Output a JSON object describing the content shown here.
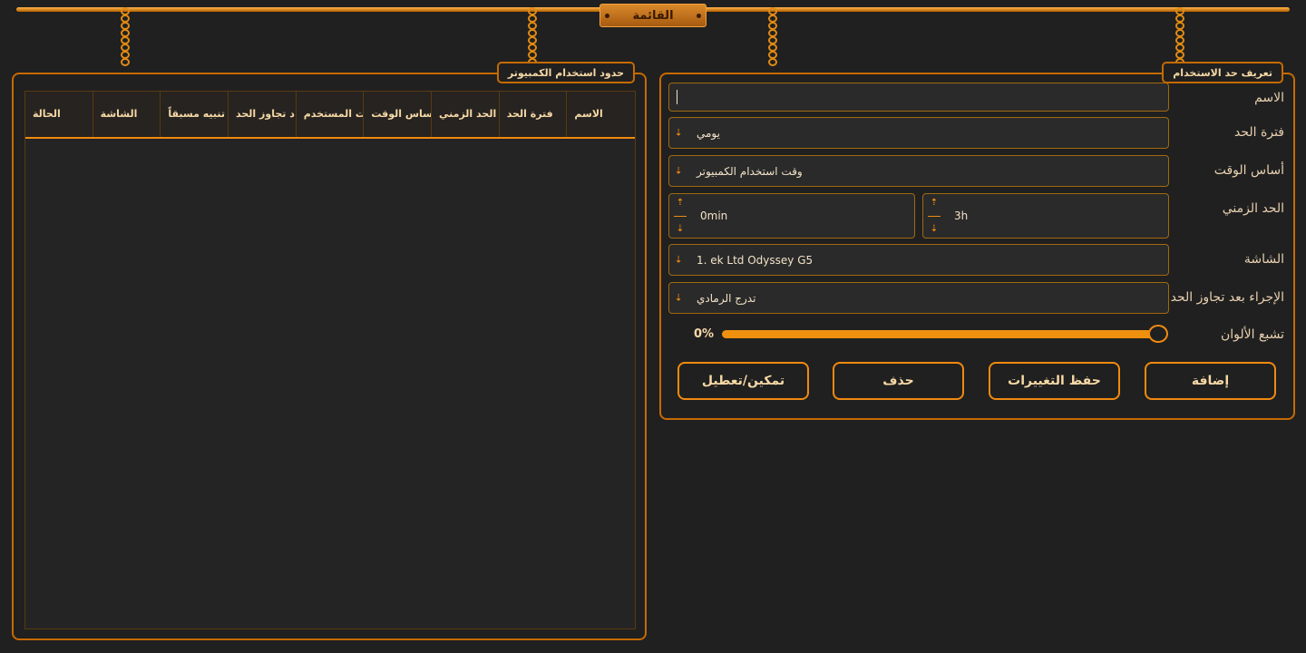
{
  "menu": {
    "label": "القائمة"
  },
  "left_panel": {
    "title": "حدود استخدام الكمبيوتر",
    "columns": [
      "الاسم",
      "فترة الحد",
      "الحد الزمني",
      "ساس الوقت",
      "ت المستخدم",
      "د تجاوز الحد",
      "تنبيه مسبقاً",
      "الشاشة",
      "الحالة"
    ],
    "rows": []
  },
  "right_panel": {
    "title": "تعريف حد الاستخدام",
    "name": {
      "label": "الاسم",
      "value": ""
    },
    "period": {
      "label": "فترة الحد",
      "value": "يومي"
    },
    "time_basis": {
      "label": "أساس الوقت",
      "value": "وقت استخدام الكمبيوتر"
    },
    "time_limit": {
      "label": "الحد الزمني",
      "hours": "3h",
      "minutes": "0min"
    },
    "monitor": {
      "label": "الشاشة",
      "value": "1. ek Ltd Odyssey G5"
    },
    "action": {
      "label": "الإجراء بعد تجاوز الحد",
      "value": "تدرج الرمادي"
    },
    "saturation": {
      "label": "تشبع الألوان",
      "value": "0%",
      "fill_fraction": 1.0
    },
    "buttons": {
      "add": "إضافة",
      "save": "حفظ التغييرات",
      "delete": "حذف",
      "toggle": "تمكين/تعطيل"
    }
  },
  "colors": {
    "accent": "#f08a10",
    "border": "#c66a00",
    "background": "#202020",
    "text": "#f7d9a6"
  }
}
